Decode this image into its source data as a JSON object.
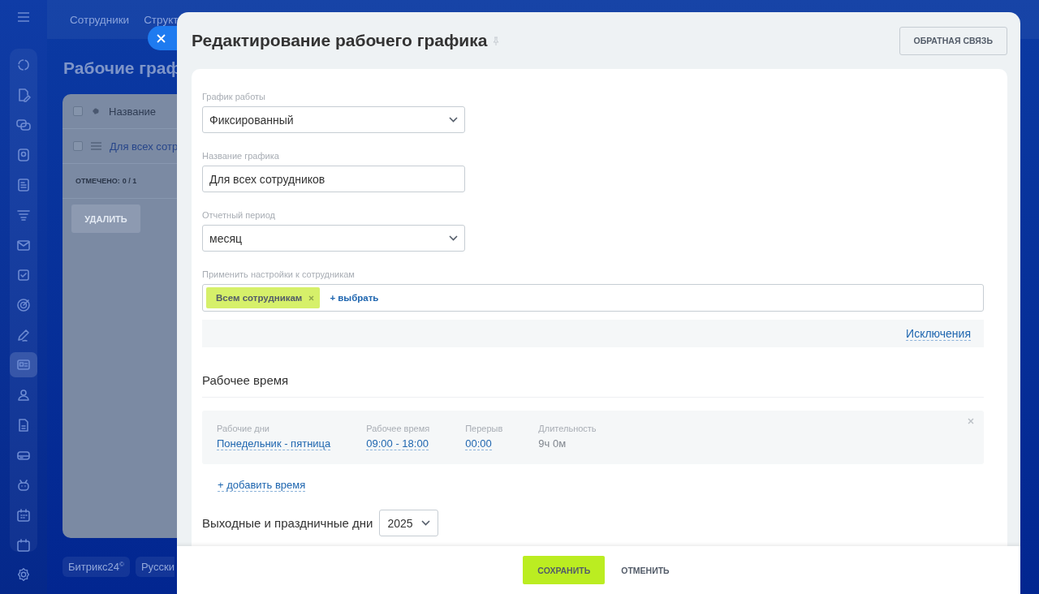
{
  "sidebar": {
    "items": [
      {
        "selected": false
      },
      {
        "selected": false
      },
      {
        "selected": false
      },
      {
        "selected": false
      },
      {
        "selected": false
      },
      {
        "selected": false
      },
      {
        "selected": false
      },
      {
        "selected": false
      },
      {
        "selected": false
      },
      {
        "selected": false
      },
      {
        "selected": true
      },
      {
        "selected": false
      },
      {
        "selected": false
      },
      {
        "selected": false
      },
      {
        "selected": false
      },
      {
        "selected": false
      },
      {
        "selected": false
      }
    ]
  },
  "background_page": {
    "top_tabs": [
      "Сотрудники",
      "Структ"
    ],
    "heading": "Рабочие граф",
    "grid": {
      "header": {
        "checked": false,
        "label": "Название"
      },
      "rows": [
        {
          "checked": false,
          "name": "Для всех сотр"
        }
      ],
      "counter_label": "ОТМЕЧЕНО:",
      "counter_value": "0 / 1",
      "delete_button": "УДАЛИТЬ"
    },
    "footer": [
      "Битрикс24$^{©}$",
      "Русски"
    ]
  },
  "slider": {
    "title": "Редактирование рабочего графика",
    "feedback_button": "ОБРАТНАЯ СВЯЗЬ",
    "fields": [
      {
        "kind": "select",
        "label": "График работы",
        "value": "Фиксированный"
      },
      {
        "kind": "text",
        "label": "Название графика",
        "value": "Для всех сотрудников"
      },
      {
        "kind": "select",
        "label": "Отчетный период",
        "value": "месяц"
      }
    ],
    "apply_to": {
      "label": "Применить настройки к сотрудникам",
      "tags": [
        "Всем сотрудникам"
      ],
      "add_link": "+ выбрать"
    },
    "exceptions_link": "Исключения",
    "work_time": {
      "heading": "Рабочее время",
      "shifts": [
        {
          "columns": [
            {
              "label": "Рабочие дни",
              "value": "Понедельник - пятница",
              "link": true
            },
            {
              "label": "Рабочее время",
              "value": "09:00 - 18:00",
              "link": true
            },
            {
              "label": "Перерыв",
              "value": "00:00",
              "link": true
            },
            {
              "label": "Длительность",
              "value": "9ч 0м",
              "link": false
            }
          ]
        }
      ],
      "add_link": "+ добавить время"
    },
    "holidays": {
      "heading": "Выходные и праздничные дни",
      "year": "2025"
    },
    "footer": {
      "save": "СОХРАНИТЬ",
      "cancel": "ОТМЕНИТЬ"
    }
  }
}
